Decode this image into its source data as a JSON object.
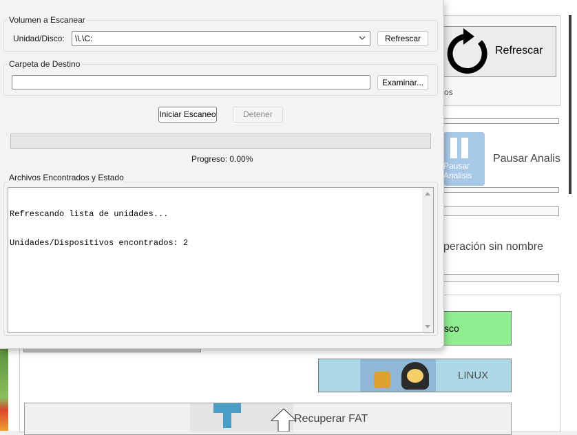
{
  "background_app": {
    "refresh_label": "Refrescar",
    "partial_text_1": "os",
    "pause_label": "Pausar Analis",
    "pause_icon_text_1": "Pausar",
    "pause_icon_text_2": "Analisis",
    "operation_label": "peración sin nombre",
    "green_button_label": "sco",
    "linux_label": "LINUX",
    "fat_label": "Recuperar FAT",
    "colors": {
      "green_button": "#90ee90",
      "linux_button": "#add8e6"
    }
  },
  "dialog": {
    "volume_group": {
      "title": "Volumen a Escanear",
      "drive_label": "Unidad/Disco:",
      "drive_value": "\\\\.\\C:",
      "refresh_button": "Refrescar"
    },
    "destination_group": {
      "title": "Carpeta de Destino",
      "path_value": "",
      "browse_button": "Examinar..."
    },
    "start_button": "Iniciar Escaneo",
    "stop_button": "Detener",
    "progress": {
      "value": 0.0,
      "label": "Progreso: 0.00%"
    },
    "files_group": {
      "title": "Archivos Encontrados y Estado",
      "log_lines": [
        "Refrescando lista de unidades...",
        "Unidades/Dispositivos encontrados: 2"
      ]
    }
  }
}
